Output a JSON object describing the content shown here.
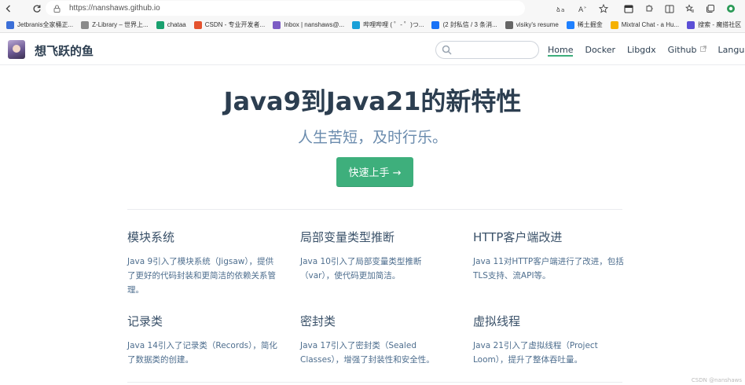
{
  "browser": {
    "url": "https://nanshaws.github.io",
    "nav_icons": [
      "back-icon",
      "refresh-icon"
    ],
    "tools": [
      "translate-icon",
      "read-aloud-icon",
      "favorite-star-icon",
      "split-screen-icon",
      "extensions-icon",
      "sidebar-icon",
      "favorites-icon",
      "collections-icon",
      "copilot-icon"
    ]
  },
  "bookmarks": [
    {
      "label": "Jetbranis全家桶正...",
      "color": "#3b6fd8"
    },
    {
      "label": "Z-Library – 世界上...",
      "color": "#8a8a8a"
    },
    {
      "label": "chataa",
      "color": "#19a06e"
    },
    {
      "label": "CSDN - 专业开发者...",
      "color": "#e4522e"
    },
    {
      "label": "Inbox | nanshaws@...",
      "color": "#7c5cc4"
    },
    {
      "label": "哔哩哔哩 ( ゜- ゜)つ...",
      "color": "#1aa0d8"
    },
    {
      "label": "(2 封私信 / 3 条消...",
      "color": "#1772f6"
    },
    {
      "label": "visiky's resume",
      "color": "#666666"
    },
    {
      "label": "稀土掘金",
      "color": "#1e80ff"
    },
    {
      "label": "Mixtral Chat - a Hu...",
      "color": "#f5b100"
    },
    {
      "label": "搜索 - 魔搭社区",
      "color": "#5b4fd6"
    }
  ],
  "site": {
    "name": "想飞跃的鱼",
    "search_placeholder": "",
    "nav": [
      {
        "label": "Home",
        "active": true
      },
      {
        "label": "Docker"
      },
      {
        "label": "Libgdx"
      },
      {
        "label": "Github",
        "external": true
      },
      {
        "label": "Languages",
        "dropdown": true
      }
    ]
  },
  "hero": {
    "title": "Java9到Java21的新特性",
    "subtitle": "人生苦短，及时行乐。",
    "action": "快速上手 →"
  },
  "features": [
    {
      "title": "模块系统",
      "details": "Java 9引入了模块系统（Jigsaw），提供了更好的代码封装和更简洁的依赖关系管理。"
    },
    {
      "title": "局部变量类型推断",
      "details": "Java 10引入了局部变量类型推断（var），使代码更加简洁。"
    },
    {
      "title": "HTTP客户端改进",
      "details": "Java 11对HTTP客户端进行了改进，包括TLS支持、流API等。"
    },
    {
      "title": "记录类",
      "details": "Java 14引入了记录类（Records），简化了数据类的创建。"
    },
    {
      "title": "密封类",
      "details": "Java 17引入了密封类（Sealed Classes），增强了封装性和安全性。"
    },
    {
      "title": "虚拟线程",
      "details": "Java 21引入了虚拟线程（Project Loom），提升了整体吞吐量。"
    }
  ],
  "watermark": "CSDN @nanshaws",
  "colors": {
    "accent": "#3eaf7c",
    "text": "#2c3e50",
    "subtitle": "#6a8bad"
  }
}
